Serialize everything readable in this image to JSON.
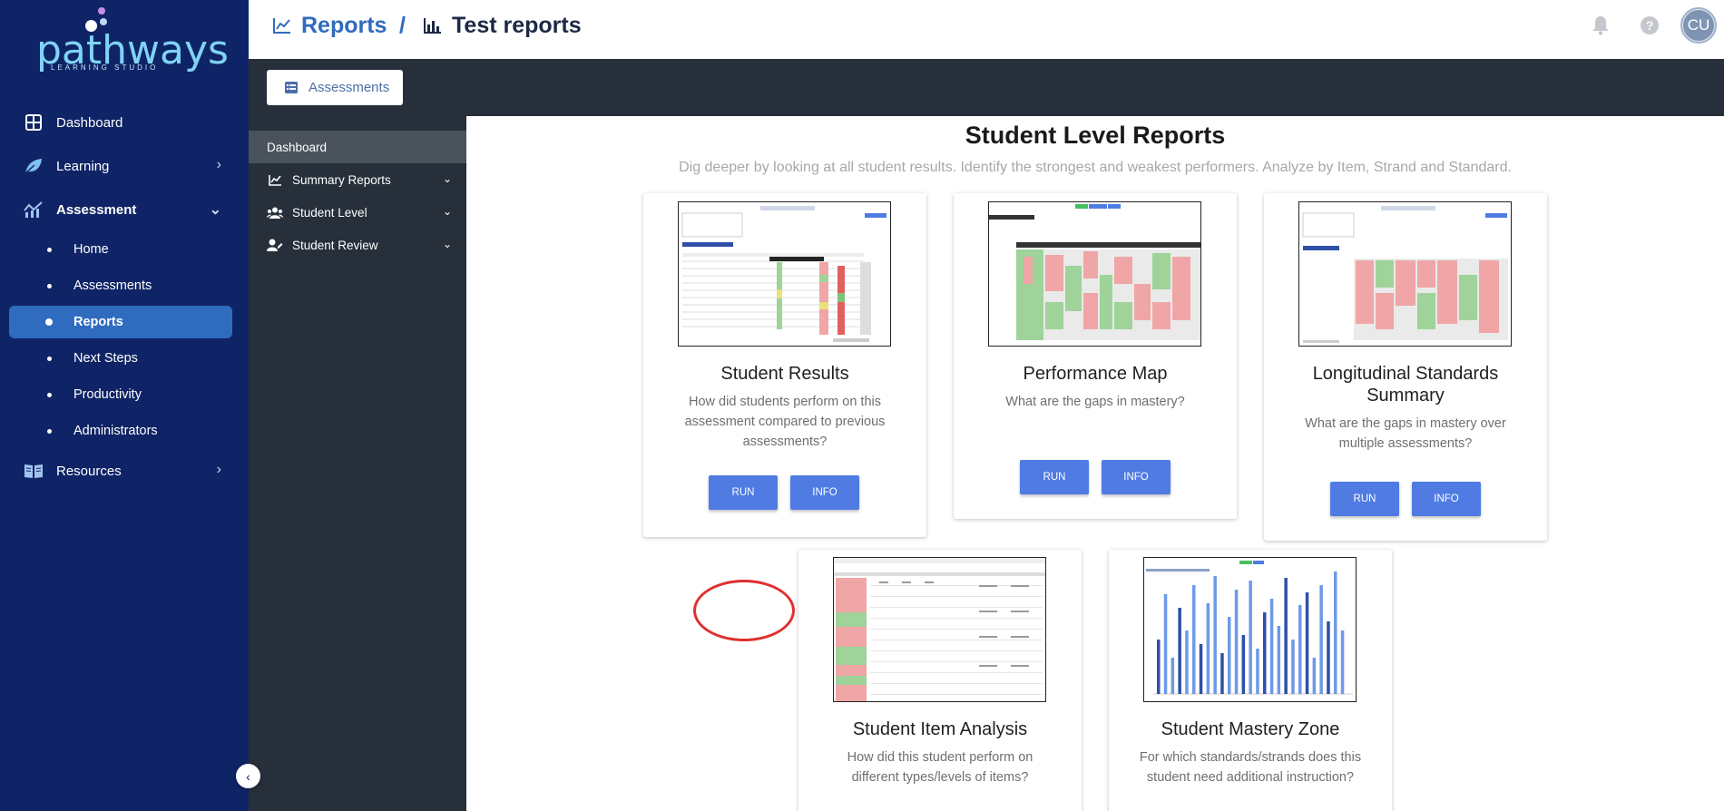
{
  "brand": {
    "name": "pathways",
    "sub": "LEARNING STUDIO"
  },
  "sidebar": {
    "items": [
      {
        "label": "Dashboard",
        "icon": "dashboard-grid-icon"
      },
      {
        "label": "Learning",
        "icon": "leaf-icon"
      },
      {
        "label": "Assessment",
        "icon": "chart-icon"
      },
      {
        "label": "Resources",
        "icon": "book-icon"
      }
    ],
    "assessment_subitems": [
      "Home",
      "Assessments",
      "Reports",
      "Next Steps",
      "Productivity",
      "Administrators"
    ],
    "active": "Reports"
  },
  "breadcrumb": {
    "first": "Reports",
    "separator": "/",
    "second": "Test reports"
  },
  "header": {
    "avatar_initials": "CU"
  },
  "tab": {
    "label": "Assessments"
  },
  "subnav": {
    "head": "Dashboard",
    "items": [
      "Summary Reports",
      "Student Level",
      "Student Review"
    ]
  },
  "main": {
    "title": "Student Level Reports",
    "subtitle": "Dig deeper by looking at all student results. Identify the strongest and weakest performers. Analyze by Item, Strand and Standard.",
    "cards": [
      {
        "title": "Student Results",
        "description": "How did students perform on this assessment compared to previous assessments?",
        "run": "RUN",
        "info": "INFO"
      },
      {
        "title": "Performance Map",
        "description": "What are the gaps in mastery?",
        "run": "RUN",
        "info": "INFO"
      },
      {
        "title": "Longitudinal Standards Summary",
        "description": "What are the gaps in mastery over multiple assessments?",
        "run": "RUN",
        "info": "INFO"
      },
      {
        "title": "Student Item Analysis",
        "description": "How did this student perform on different types/levels of items?"
      },
      {
        "title": "Student Mastery Zone",
        "description": "For which standards/strands does this student need additional instruction?"
      }
    ]
  },
  "colors": {
    "sidebar": "#0f2466",
    "accent": "#2f6bbf",
    "button": "#4f7be3",
    "dark": "#262f3a"
  }
}
